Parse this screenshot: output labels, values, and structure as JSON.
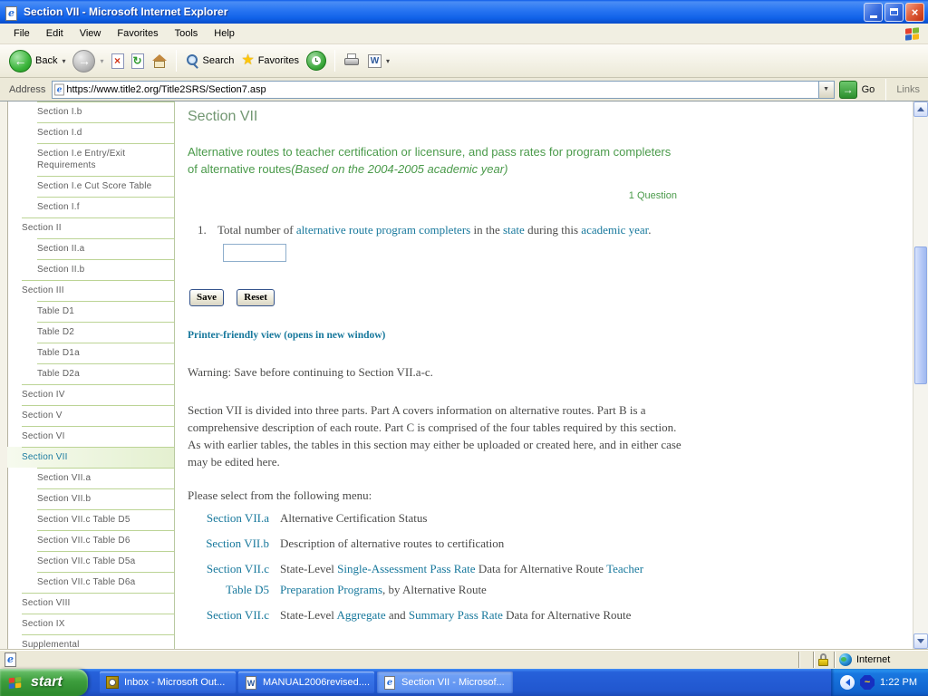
{
  "window": {
    "title": "Section VII - Microsoft Internet Explorer"
  },
  "menu_bar": {
    "items": [
      "File",
      "Edit",
      "View",
      "Favorites",
      "Tools",
      "Help"
    ]
  },
  "toolbar": {
    "back_label": "Back",
    "search_label": "Search",
    "favorites_label": "Favorites"
  },
  "address_bar": {
    "label": "Address",
    "url": "https://www.title2.org/Title2SRS/Section7.asp",
    "go_label": "Go",
    "links_label": "Links"
  },
  "sidebar": {
    "items": [
      {
        "label": "Section I.b",
        "cls": "sub"
      },
      {
        "label": "Section I.d",
        "cls": "sub"
      },
      {
        "label": "Section I.e Entry/Exit Requirements",
        "cls": "sub"
      },
      {
        "label": "Section I.e Cut Score Table",
        "cls": "sub"
      },
      {
        "label": "Section I.f",
        "cls": "sub"
      },
      {
        "label": "Section II",
        "cls": "top"
      },
      {
        "label": "Section II.a",
        "cls": "sub"
      },
      {
        "label": "Section II.b",
        "cls": "sub"
      },
      {
        "label": "Section III",
        "cls": "top"
      },
      {
        "label": "Table D1",
        "cls": "sub"
      },
      {
        "label": "Table D2",
        "cls": "sub"
      },
      {
        "label": "Table D1a",
        "cls": "sub"
      },
      {
        "label": "Table D2a",
        "cls": "sub"
      },
      {
        "label": "Section IV",
        "cls": "top"
      },
      {
        "label": "Section V",
        "cls": "top"
      },
      {
        "label": "Section VI",
        "cls": "top"
      },
      {
        "label": "Section VII",
        "cls": "top active"
      },
      {
        "label": "Section VII.a",
        "cls": "sub"
      },
      {
        "label": "Section VII.b",
        "cls": "sub"
      },
      {
        "label": "Section VII.c Table D5",
        "cls": "sub"
      },
      {
        "label": "Section VII.c Table D6",
        "cls": "sub"
      },
      {
        "label": "Section VII.c Table D5a",
        "cls": "sub"
      },
      {
        "label": "Section VII.c Table D6a",
        "cls": "sub"
      },
      {
        "label": "Section VIII",
        "cls": "top"
      },
      {
        "label": "Section IX",
        "cls": "top"
      },
      {
        "label": "Supplemental",
        "cls": "top"
      }
    ]
  },
  "main": {
    "heading": "Section VII",
    "subtitle": "Alternative routes to teacher certification or licensure, and pass rates for program completers of alternative routes",
    "subtitle_italic": "(Based on the 2004-2005 academic year)",
    "question_count": "1 Question",
    "question": {
      "number": "1.",
      "segments": [
        {
          "t": "Total number of ",
          "cls": ""
        },
        {
          "t": "alternative route program completers",
          "cls": "tlink"
        },
        {
          "t": " in the ",
          "cls": ""
        },
        {
          "t": "state",
          "cls": "tlink"
        },
        {
          "t": " during this ",
          "cls": ""
        },
        {
          "t": "academic year",
          "cls": "tlink"
        },
        {
          "t": ".",
          "cls": ""
        }
      ]
    },
    "save_label": "Save",
    "reset_label": "Reset",
    "printer_link": "Printer-friendly view (opens in new window)",
    "warning": "Warning: Save before continuing to Section VII.a-c.",
    "paragraph": "Section VII is divided into three parts. Part A covers information on alternative routes. Part B is a comprehensive description of each route. Part C is comprised of the four tables required by this section. As with earlier tables, the tables in this section may either be uploaded or created here, and in either case may be edited here.",
    "menu_intro": "Please select from the following menu:",
    "menu": [
      {
        "label": "Section VII.a",
        "label2": "",
        "desc": [
          {
            "t": "Alternative Certification Status",
            "cls": ""
          }
        ]
      },
      {
        "label": "Section VII.b",
        "label2": "",
        "desc": [
          {
            "t": "Description of alternative routes to certification",
            "cls": ""
          }
        ]
      },
      {
        "label": "Section VII.c",
        "label2": "Table D5",
        "desc": [
          {
            "t": "State-Level ",
            "cls": ""
          },
          {
            "t": "Single-Assessment Pass Rate",
            "cls": "tlink"
          },
          {
            "t": " Data for Alternative Route ",
            "cls": ""
          },
          {
            "t": "Teacher Preparation Programs",
            "cls": "tlink"
          },
          {
            "t": ", by Alternative Route",
            "cls": ""
          }
        ]
      },
      {
        "label": "Section VII.c",
        "label2": "",
        "desc": [
          {
            "t": "State-Level ",
            "cls": ""
          },
          {
            "t": "Aggregate",
            "cls": "tlink"
          },
          {
            "t": " and ",
            "cls": ""
          },
          {
            "t": "Summary Pass Rate",
            "cls": "tlink"
          },
          {
            "t": " Data for Alternative Route",
            "cls": ""
          }
        ]
      }
    ]
  },
  "status_bar": {
    "zone": "Internet"
  },
  "taskbar": {
    "start_label": "start",
    "tasks": [
      {
        "title": "Inbox - Microsoft Out...",
        "icon": "outlook-icon"
      },
      {
        "title": "MANUAL2006revised....",
        "icon": "word-icon"
      },
      {
        "title": "Section VII - Microsof...",
        "icon": "ie-icon",
        "active": true
      }
    ],
    "time": "1:22 PM"
  },
  "colors": {
    "link_teal": "#17789c",
    "green_text": "#4a9a4a",
    "heading_green": "#729772",
    "sidebar_divider": "#bcd495",
    "active_item_bg": "#e8f2d8",
    "titlebar_blue": "#2b6ff0",
    "taskbar_blue": "#2661da",
    "start_green": "#3d9e3d"
  }
}
